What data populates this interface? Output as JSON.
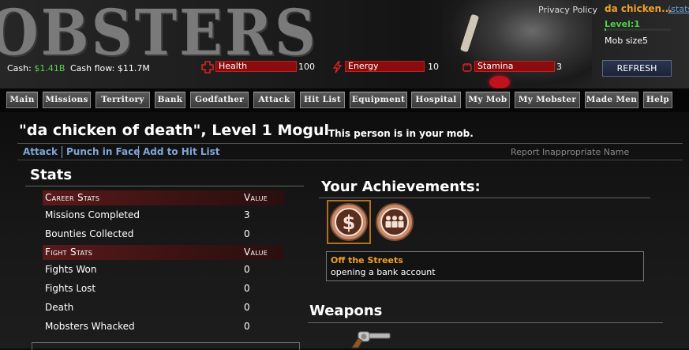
{
  "header": {
    "logo_text": "OBSTERS",
    "privacy_link": "Privacy Policy",
    "player_name": "da chicken...",
    "stats_link": "(stats",
    "level_label": "Level:1",
    "level_progress": 0.02,
    "mob_size_label": "Mob size:",
    "mob_size_value": "5",
    "refresh_label": "REFRESH",
    "cash_label": "Cash:",
    "cash_value": "$1.41B",
    "cashflow_label": "Cash flow:",
    "cashflow_value": "$11.7M",
    "health_label": "Health",
    "health_value": "100",
    "energy_label": "Energy",
    "energy_value": "10",
    "stamina_label": "Stamina",
    "stamina_value": "3"
  },
  "nav": {
    "items": [
      "Main",
      "Missions",
      "Territory",
      "Bank",
      "Godfather",
      "Attack",
      "Hit List",
      "Equipment",
      "Hospital",
      "My Mob",
      "My Mobster",
      "Made Men",
      "Help"
    ]
  },
  "profile": {
    "title": "\"da chicken of death\", Level 1 Mogul",
    "mob_note": "This person is in your mob.",
    "actions": [
      "Attack",
      "Punch in Face",
      "Add to Hit List"
    ],
    "report_link": "Report Inappropriate Name"
  },
  "stats": {
    "heading": "Stats",
    "career_header": "Career Stats",
    "career_value_header": "Value",
    "career_rows": [
      {
        "label": "Missions Completed",
        "value": "3"
      },
      {
        "label": "Bounties Collected",
        "value": "0"
      }
    ],
    "fight_header": "Fight Stats",
    "fight_value_header": "Value",
    "fight_rows": [
      {
        "label": "Fights Won",
        "value": "0"
      },
      {
        "label": "Fights Lost",
        "value": "0"
      },
      {
        "label": "Death",
        "value": "0"
      },
      {
        "label": "Mobsters Whacked",
        "value": "0"
      }
    ]
  },
  "achievements": {
    "heading": "Your Achievements:",
    "badges": [
      "dollar-badge-icon",
      "mob-badge-icon"
    ],
    "selected_title": "Off the Streets",
    "selected_desc": "opening a bank account"
  },
  "weapons": {
    "heading": "Weapons",
    "items": [
      "revolver-icon"
    ]
  },
  "colors": {
    "accent_orange": "#f0a02a",
    "cash_green": "#57d24b",
    "link_blue": "#7fa6d8",
    "stat_bar_red": "#8a0c0c"
  }
}
